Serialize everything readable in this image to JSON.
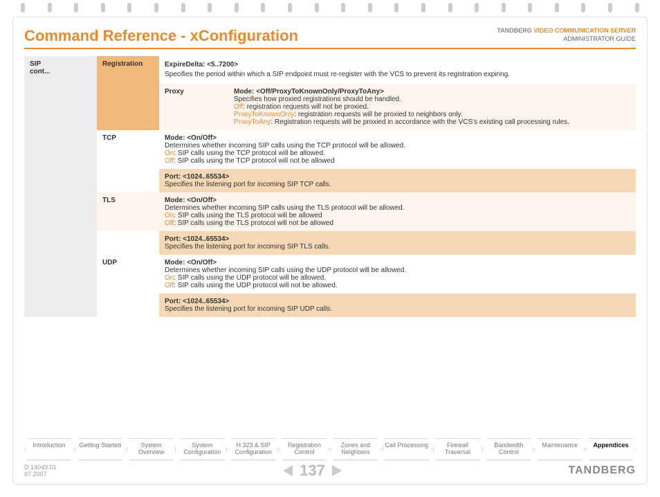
{
  "header": {
    "title": "Command Reference - xConfiguration",
    "brand_grey": "TANDBERG",
    "brand_orange": "VIDEO COMMUNICATION SERVER",
    "subtitle": "ADMINISTRATOR GUIDE"
  },
  "sip_label": "SIP\ncont...",
  "registration": {
    "label": "Registration",
    "expire_title": "ExpireDelta: <5..7200>",
    "expire_desc": "Specifies the period within which a SIP endpoint must re-register with the VCS to prevent its registration expiring.",
    "proxy_label": "Proxy",
    "proxy_mode_title": "Mode: <Off/ProxyToKnownOnly/ProxyToAny>",
    "proxy_mode_desc": "Specifies how proxied registrations should be handled.",
    "proxy_off_key": "Off",
    "proxy_off_val": ": registration requests will not be proxied.",
    "proxy_known_key": "ProxyToKnownOnly",
    "proxy_known_val": ": registration requests will be proxied to neighbors only.",
    "proxy_any_key": "ProxyToAny",
    "proxy_any_val": ": Registration requests will be proxied in accordance with the VCS's existing call processing rules."
  },
  "tcp": {
    "label": "TCP",
    "mode_title": "Mode: <On/Off>",
    "mode_desc": "Determines whether incoming SIP calls using the TCP protocol will be allowed.",
    "on_key": "On",
    "on_val": ": SIP calls using the TCP protocol will be allowed.",
    "off_key": "Off",
    "off_val": ": SIP calls using the TCP protocol will not be allowed",
    "port_title": "Port: <1024..65534>",
    "port_desc": "Specifies the listening port for incoming SIP TCP calls."
  },
  "tls": {
    "label": "TLS",
    "mode_title": "Mode: <On/Off>",
    "mode_desc": "Determines whether incoming SIP calls using the TLS protocol will be allowed.",
    "on_key": "On",
    "on_val": ": SIP calls using the TLS protocol will be allowed",
    "off_key": "Off",
    "off_val": ": SIP calls using the TLS protocol will not be allowed",
    "port_title": "Port: <1024..65534>",
    "port_desc": "Specifies the listening port for incoming SIP TLS calls."
  },
  "udp": {
    "label": "UDP",
    "mode_title": "Mode: <On/Off>",
    "mode_desc": "Determines whether incoming SIP calls using the UDP protocol will be allowed.",
    "on_key": "On",
    "on_val": ": SIP calls using the UDP protocol will be allowed.",
    "off_key": "Off",
    "off_val": ": SIP calls using the UDP protocol will not be allowed.",
    "port_title": "Port: <1024..65534>",
    "port_desc": "Specifies the listening port for incoming SIP UDP calls."
  },
  "tabs": [
    "Introduction",
    "Getting Started",
    "System Overview",
    "System Configuration",
    "H.323 & SIP Configuration",
    "Registration Control",
    "Zones and Neighbors",
    "Call Processing",
    "Firewall Traversal",
    "Bandwidth Control",
    "Maintenance",
    "Appendices"
  ],
  "footer": {
    "doc_id": "D 14049.01",
    "date": "07.2007",
    "page": "137",
    "brand": "TANDBERG"
  }
}
